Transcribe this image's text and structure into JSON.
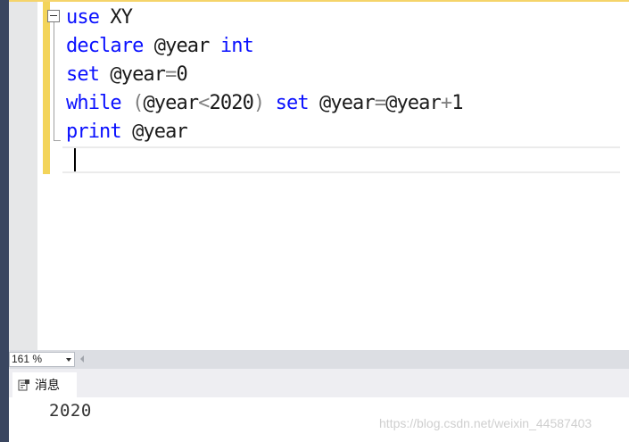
{
  "editor": {
    "lines": [
      [
        {
          "t": "use",
          "c": "kw"
        },
        {
          "t": " XY",
          "c": "plain"
        }
      ],
      [
        {
          "t": "declare",
          "c": "kw"
        },
        {
          "t": " @year ",
          "c": "plain"
        },
        {
          "t": "int",
          "c": "kw"
        }
      ],
      [
        {
          "t": "set",
          "c": "kw"
        },
        {
          "t": " @year",
          "c": "plain"
        },
        {
          "t": "=",
          "c": "gray"
        },
        {
          "t": "0",
          "c": "plain"
        }
      ],
      [
        {
          "t": "while",
          "c": "kw"
        },
        {
          "t": " (",
          "c": "gray"
        },
        {
          "t": "@year",
          "c": "plain"
        },
        {
          "t": "<",
          "c": "gray"
        },
        {
          "t": "2020",
          "c": "plain"
        },
        {
          "t": ")",
          "c": "gray"
        },
        {
          "t": " set",
          "c": "kw"
        },
        {
          "t": " @year",
          "c": "plain"
        },
        {
          "t": "=",
          "c": "gray"
        },
        {
          "t": "@year",
          "c": "plain"
        },
        {
          "t": "+",
          "c": "gray"
        },
        {
          "t": "1",
          "c": "plain"
        }
      ],
      [
        {
          "t": "print",
          "c": "kw"
        },
        {
          "t": " @year",
          "c": "plain"
        }
      ]
    ]
  },
  "status": {
    "zoom": "161 %"
  },
  "results": {
    "tab_label": "消息",
    "output": "2020"
  },
  "watermark": "https://blog.csdn.net/weixin_44587403",
  "colors": {
    "keyword": "#0a10ff",
    "operator": "#808080",
    "change_bar": "#f3d45a"
  },
  "icons": {
    "collapse": "minus-box-icon",
    "messages": "message-doc-icon"
  }
}
